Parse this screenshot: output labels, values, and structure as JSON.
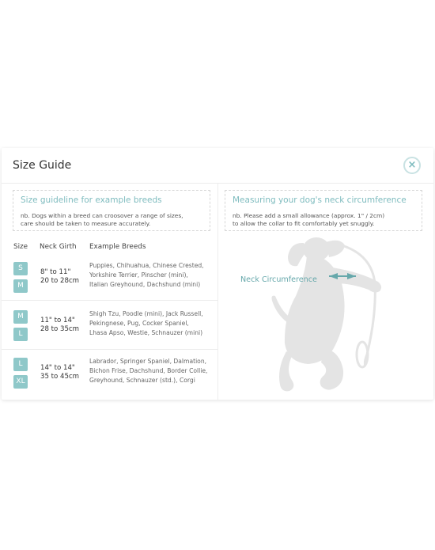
{
  "modal": {
    "title": "Size Guide",
    "close_label": "×"
  },
  "left": {
    "note_title": "Size guideline for example breeds",
    "note_lines": [
      "nb. Dogs within a breed can croosover a range of sizes,",
      "care should be taken to measure accurately."
    ],
    "headers": {
      "size": "Size",
      "girth": "Neck Girth",
      "breeds": "Example Breeds"
    },
    "rows": [
      {
        "sizes": [
          "S",
          "M"
        ],
        "girth": [
          "8\" to 11\"",
          "20 to 28cm"
        ],
        "breeds": [
          "Puppies, Chihuahua, Chinese Crested,",
          "Yorkshire Terrier, Pinscher (mini),",
          "Italian Greyhound, Dachshund (mini)"
        ]
      },
      {
        "sizes": [
          "M",
          "L"
        ],
        "girth": [
          "11\" to 14\"",
          "28 to 35cm"
        ],
        "breeds": [
          "Shigh Tzu, Poodle (mini), Jack Russell,",
          "Pekingnese, Pug, Cocker Spaniel,",
          "Lhasa Apso, Westie, Schnauzer (mini)"
        ]
      },
      {
        "sizes": [
          "L",
          "XL"
        ],
        "girth": [
          "14\" to 14\"",
          "35 to 45cm"
        ],
        "breeds": [
          "Labrador, Springer Spaniel, Dalmation,",
          "Bichon Frise, Dachshund, Border Collie,",
          "Greyhound, Schnauzer (std.), Corgi"
        ]
      }
    ]
  },
  "right": {
    "note_title": "Measuring your dog's neck circumference",
    "note_lines": [
      "nb. Please add a small allowance (approx. 1\" / 2cm)",
      "to allow the collar to fit comfortably yet snuggly."
    ],
    "diagram_label": "Neck Circumference"
  },
  "colors": {
    "accent": "#7fbcbf",
    "badge": "#8fc8c9",
    "dog": "#e4e4e4"
  },
  "icons": {
    "close": "close-icon",
    "dog": "dog-illustration",
    "arrows": "measure-arrows-icon"
  }
}
